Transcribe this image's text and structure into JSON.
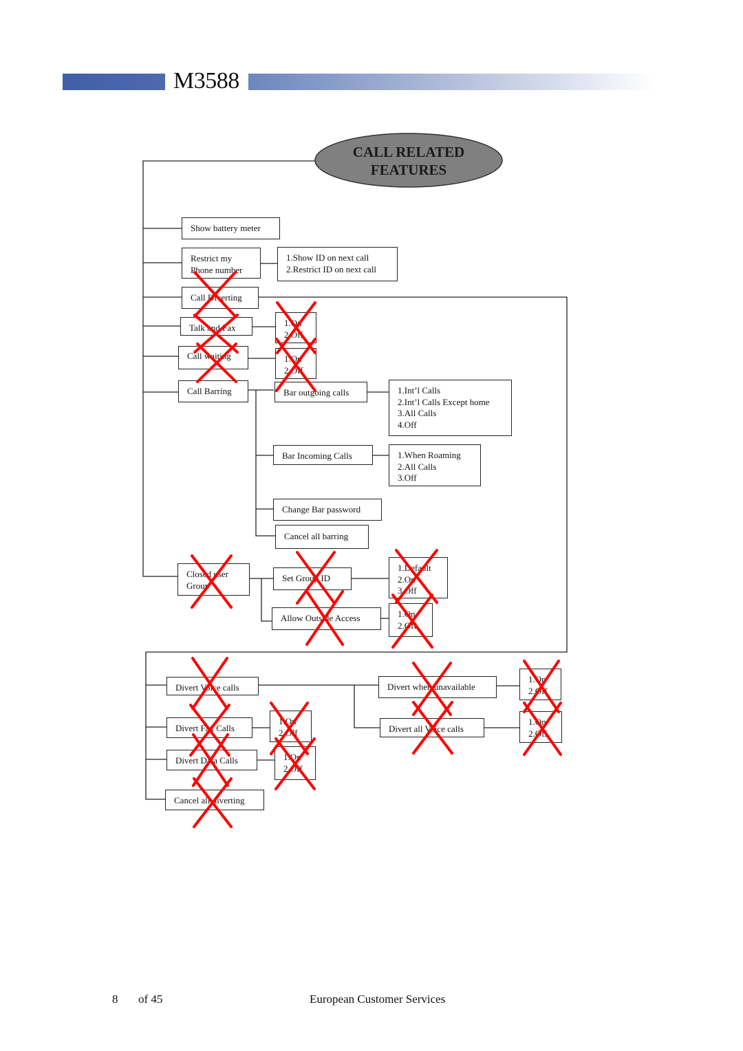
{
  "header": {
    "model": "M3588",
    "accent_color": "#4e6aae"
  },
  "root": {
    "title_line1": "CALL RELATED",
    "title_line2": "FEATURES",
    "fill_color": "#808080"
  },
  "nodes": {
    "show_battery": "Show battery meter",
    "restrict_number": "Restrict my\nPhone number",
    "restrict_options": "1.Show ID on next call\n2.Restrict ID on next call",
    "call_diverting": "Call Diverting",
    "talk_and_fax": "Talk and Fax",
    "talk_and_fax_options": "1.On\n2.Off",
    "call_waiting": "Call waiting",
    "call_waiting_options": "1.On\n2.Off",
    "call_barring": "Call Barring",
    "bar_outgoing": "Bar outgoing calls",
    "bar_outgoing_options": "1.Int’l Calls\n2.Int’l Calls Except home\n3.All Calls\n4.Off",
    "bar_incoming": "Bar Incoming Calls",
    "bar_incoming_options": "1.When Roaming\n2.All Calls\n3.Off",
    "change_bar_password": "Change Bar password",
    "cancel_all_barring": "Cancel all barring",
    "closed_user_group": "Closed user\nGroup",
    "set_group_id": "Set Group ID",
    "set_group_id_options": "1.Default\n2.On\n3.Off",
    "allow_outside_access": "Allow Outside Access",
    "allow_outside_access_options": "1.On\n2.Off",
    "divert_voice": "Divert Voice calls",
    "divert_fax": "Divert Fax Calls",
    "divert_fax_options": "1.On\n2.Off",
    "divert_data": "Divert Data Calls",
    "divert_data_options": "1.On\n2.Off",
    "cancel_all_diverting": "Cancel all diverting",
    "divert_unavailable": "Divert when unavailable",
    "divert_unavailable_options": "1.On\n2.Off",
    "divert_all_voice": "Divert all Voice calls",
    "divert_all_voice_options": "1.On\n2.Off"
  },
  "crossed_out_color": "#ff0000",
  "footer": {
    "page_number": "8",
    "page_total": "of 45",
    "department": "European Customer Services"
  }
}
